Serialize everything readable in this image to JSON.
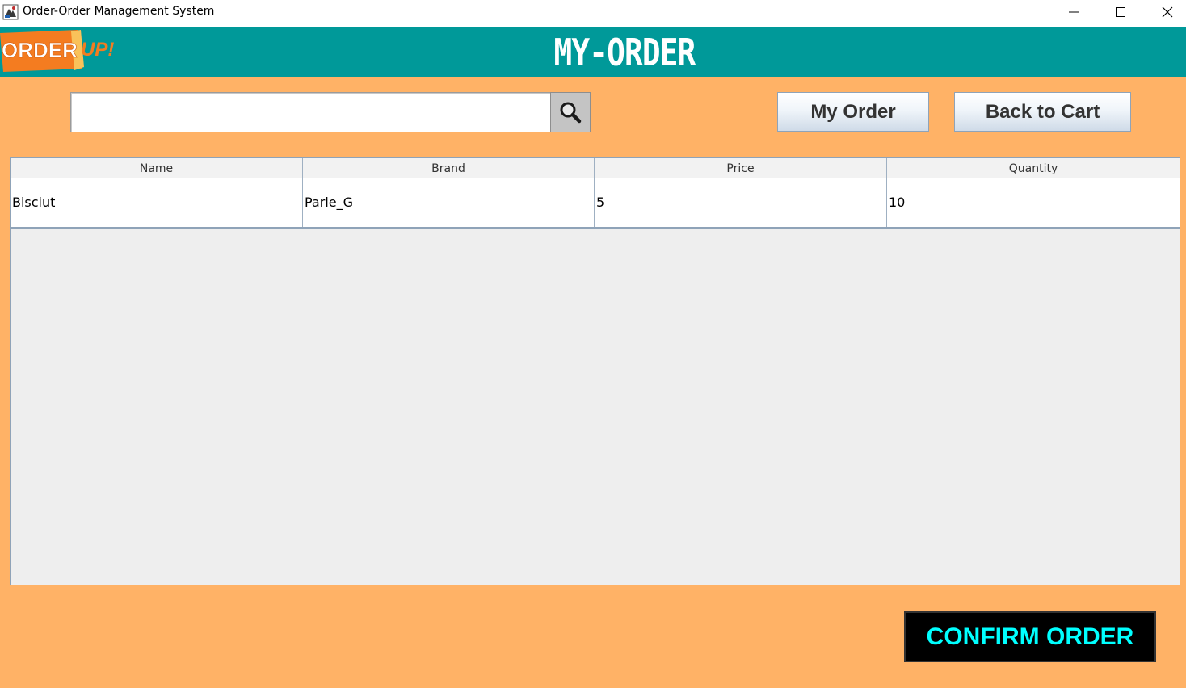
{
  "window": {
    "title": "Order-Order Management System"
  },
  "header": {
    "logo_text_left": "ORDER",
    "logo_text_right": "UP!",
    "page_title": "MY-ORDER"
  },
  "search": {
    "value": "",
    "placeholder": ""
  },
  "toolbar": {
    "my_order_label": "My Order",
    "back_to_cart_label": "Back to Cart"
  },
  "table": {
    "columns": [
      "Name",
      "Brand",
      "Price",
      "Quantity"
    ],
    "rows": [
      [
        "Bisciut",
        "Parle_G",
        "5",
        "10"
      ]
    ]
  },
  "footer": {
    "confirm_label": "CONFIRM ORDER"
  },
  "colors": {
    "background": "#ffb266",
    "header": "#009999",
    "confirm_text": "#00ffff"
  },
  "icons": {
    "search": "search-icon",
    "minimize": "minimize-icon",
    "maximize": "maximize-icon",
    "close": "close-icon"
  }
}
